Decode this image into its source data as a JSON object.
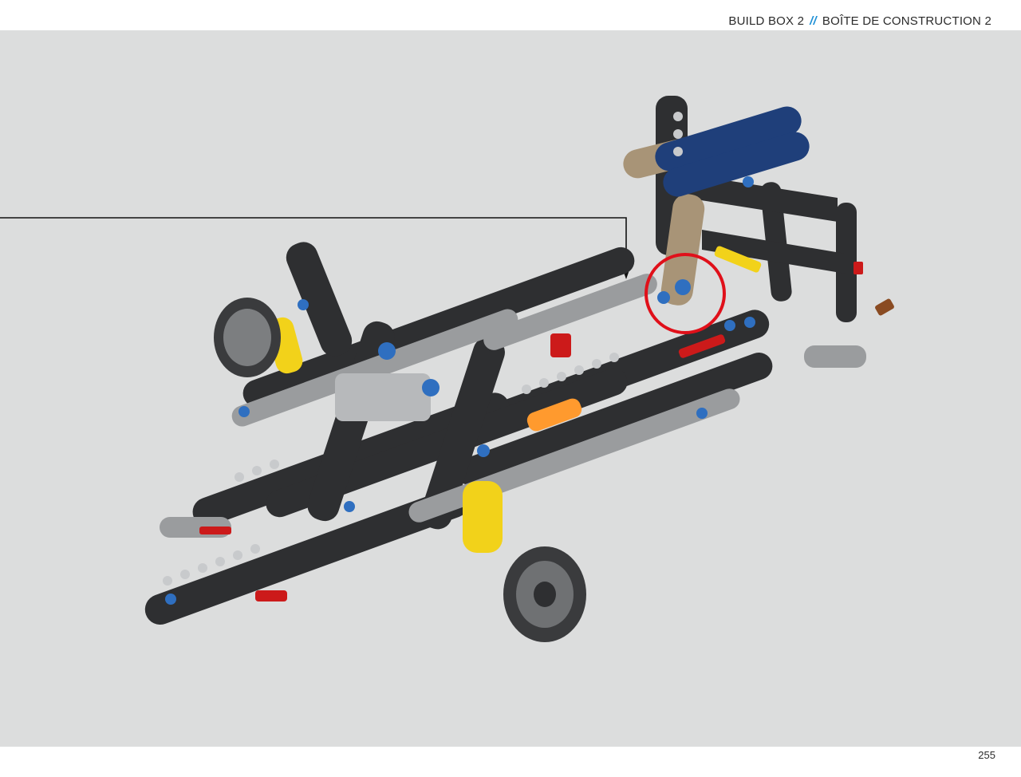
{
  "header": {
    "title_en": "BUILD BOX 2",
    "separator": "//",
    "title_fr": "BOÎTE DE CONSTRUCTION 2"
  },
  "footer": {
    "page_number": "255"
  },
  "colors": {
    "background": "#dcdddd",
    "accent": "#1e90d6",
    "highlight": "#e0101a",
    "beam_dark": "#2e2f31",
    "beam_grey": "#9a9c9e",
    "beam_blue": "#1f3f7a",
    "beam_tan": "#a89477",
    "pin_blue": "#2f6fc0",
    "beam_yellow": "#f2d21a"
  },
  "illustration": {
    "icon": "lego-technic-chassis-icon",
    "callout_icon": "red-circle-highlight-icon",
    "pointer_icon": "arrow-down-icon"
  }
}
